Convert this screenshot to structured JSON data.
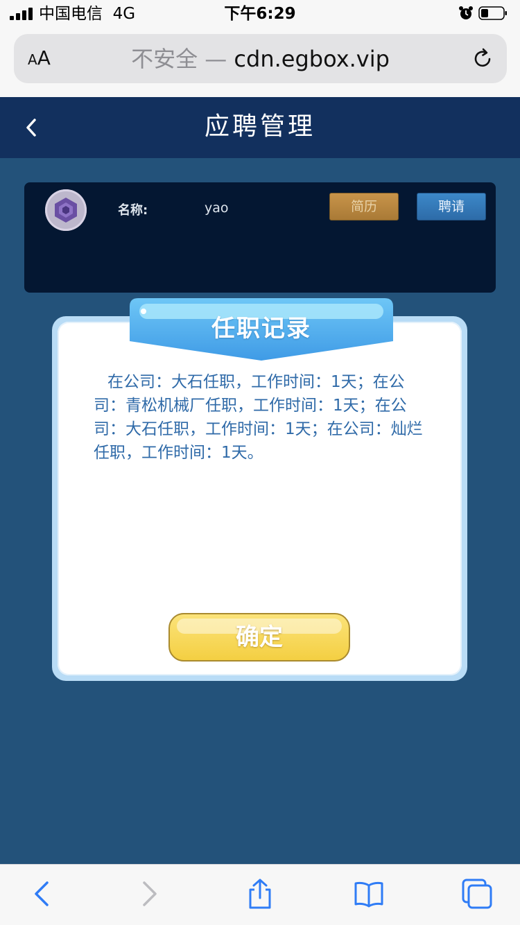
{
  "status_bar": {
    "carrier": "中国电信",
    "network": "4G",
    "time": "下午6:29"
  },
  "browser": {
    "text_size_label_small": "A",
    "text_size_label_large": "A",
    "insecure_label": "不安全 —",
    "domain": "cdn.egbox.vip"
  },
  "header": {
    "title": "应聘管理"
  },
  "profile": {
    "name_label": "名称:",
    "name_value": "yao",
    "resume_button": "简历",
    "invite_button": "聘请"
  },
  "dialog": {
    "title": "任职记录",
    "body": "在公司：大石任职，工作时间：1天；在公司：青松机械厂任职，工作时间：1天；在公司：大石任职，工作时间：1天；在公司：灿烂任职，工作时间：1天。",
    "confirm_button": "确定"
  },
  "colors": {
    "page_background": "#23527a",
    "header_background": "#12305e",
    "card_background": "#041732",
    "dialog_text": "#2f6aa8",
    "resume_button": "#b3843d",
    "invite_button": "#3579b8",
    "confirm_button": "#f6d452",
    "ios_link_blue": "#2f7cf6"
  },
  "icons": {
    "back": "chevron-left-icon",
    "reload": "reload-icon",
    "toolbar": [
      "back-arrow-icon",
      "forward-arrow-icon",
      "share-icon",
      "bookmarks-icon",
      "tabs-icon"
    ]
  }
}
